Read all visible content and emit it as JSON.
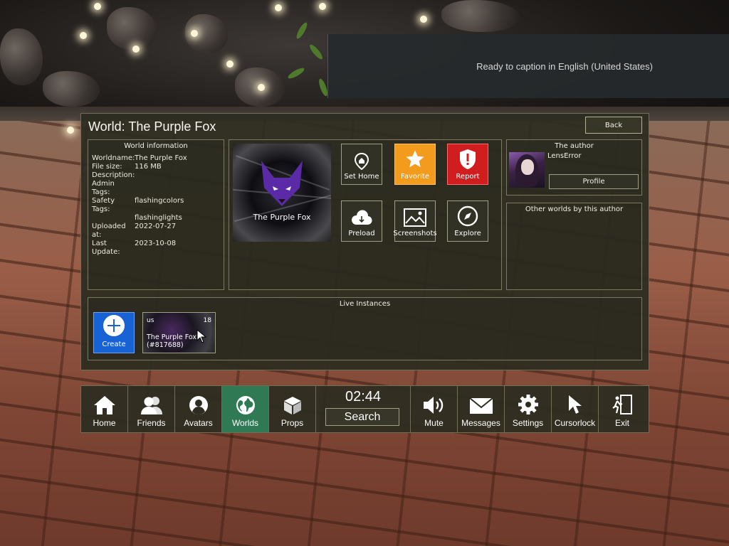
{
  "caption": {
    "text": "Ready to caption in English (United States)"
  },
  "panel": {
    "title": "World: The Purple Fox",
    "back_label": "Back"
  },
  "world_info": {
    "heading": "World information",
    "rows": [
      {
        "key": "Worldname:",
        "value": "The Purple Fox"
      },
      {
        "key": "File size:",
        "value": "116 MB"
      },
      {
        "key": "Description:",
        "value": ""
      },
      {
        "key": "Admin Tags:",
        "value": ""
      },
      {
        "key": "Safety Tags:",
        "value": "flashingcolors"
      },
      {
        "key": "",
        "value": "flashinglights"
      },
      {
        "key": "Uploaded at:",
        "value": "2022-07-27"
      },
      {
        "key": "Last Update:",
        "value": "2023-10-08"
      }
    ]
  },
  "thumbnail": {
    "label": "The Purple Fox"
  },
  "actions": {
    "set_home": "Set Home",
    "favorite": "Favorite",
    "report": "Report",
    "preload": "Preload",
    "screenshots": "Screenshots",
    "explore": "Explore"
  },
  "author": {
    "heading": "The author",
    "name": "LensError",
    "profile_label": "Profile"
  },
  "other_worlds": {
    "heading": "Other worlds by this author"
  },
  "live_instances": {
    "heading": "Live Instances",
    "create_label": "Create",
    "instances": [
      {
        "region": "us",
        "count": "18",
        "name": "The Purple Fox",
        "id": "(#817688)"
      }
    ]
  },
  "dock": {
    "home": "Home",
    "friends": "Friends",
    "avatars": "Avatars",
    "worlds": "Worlds",
    "props": "Props",
    "clock": "02:44",
    "search": "Search",
    "mute": "Mute",
    "messages": "Messages",
    "settings": "Settings",
    "cursorlock": "Cursorlock",
    "exit": "Exit"
  },
  "colors": {
    "panel_bg": "#2c2c20",
    "favorite": "#f39b1d",
    "report": "#d01e1e",
    "create": "#1763d6",
    "active_tab": "#2f7a55"
  }
}
